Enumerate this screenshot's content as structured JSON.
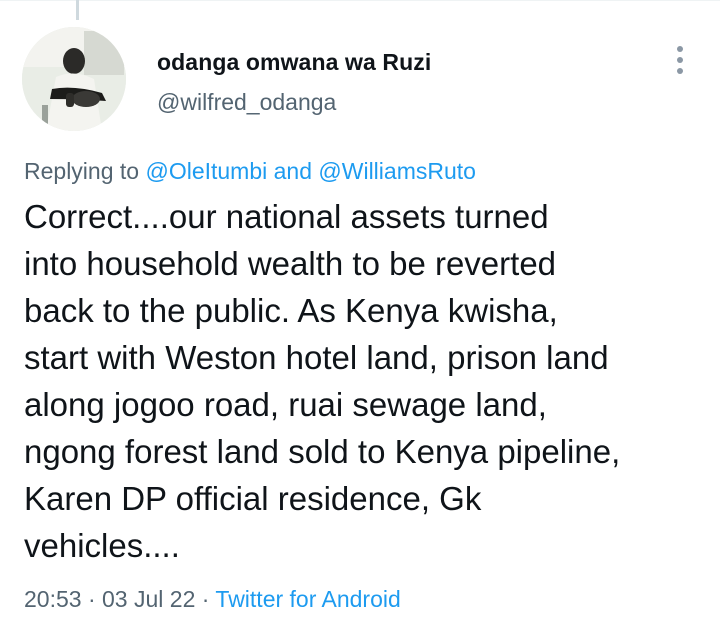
{
  "tweet": {
    "display_name": "odanga omwana wa Ruzi",
    "handle": "@wilfred_odanga",
    "replying_prefix": "Replying to",
    "reply_mentions": [
      "@OleItumbi",
      "@WilliamsRuto"
    ],
    "reply_joiner": "and",
    "body_lines": [
      "Correct....our national assets turned",
      "into household wealth to be reverted",
      "back to the public. As Kenya kwisha,",
      "start with Weston hotel land, prison land",
      "along jogoo road, ruai sewage land,",
      "ngong forest land sold to Kenya pipeline,",
      "Karen DP official residence, Gk",
      "vehicles...."
    ],
    "time": "20:53",
    "separator": "·",
    "date": "03 Jul 22",
    "source": "Twitter for Android"
  },
  "icons": {
    "more": "more-options-icon"
  },
  "colors": {
    "link": "#1d9bf0",
    "text": "#0f1419",
    "secondary": "#536471",
    "icon": "#8b98a5"
  }
}
